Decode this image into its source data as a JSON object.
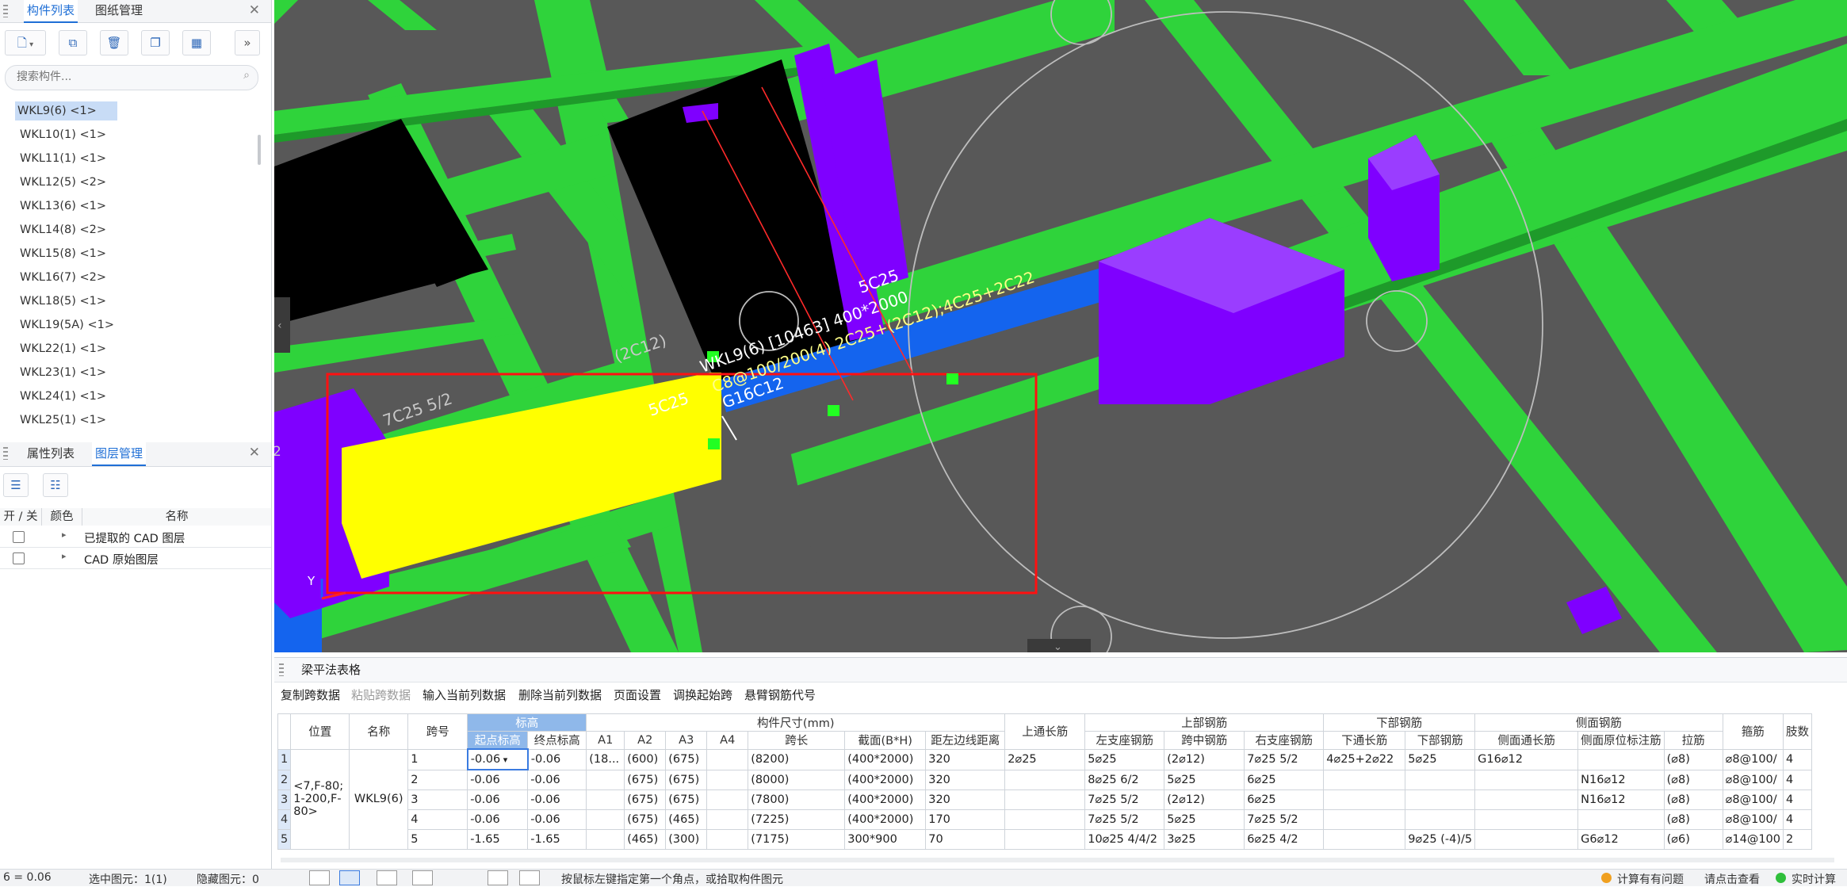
{
  "component_panel": {
    "tabs": [
      "构件列表",
      "图纸管理"
    ],
    "active_tab": 0,
    "search_placeholder": "搜索构件...",
    "items": [
      "WKL9(6) <1>",
      "WKL10(1) <1>",
      "WKL11(1) <1>",
      "WKL12(5) <2>",
      "WKL13(6) <1>",
      "WKL14(8) <2>",
      "WKL15(8) <1>",
      "WKL16(7) <2>",
      "WKL18(5) <1>",
      "WKL19(5A) <1>",
      "WKL22(1) <1>",
      "WKL23(1) <1>",
      "WKL24(1) <1>",
      "WKL25(1) <1>"
    ],
    "selected_index": 0
  },
  "layer_panel": {
    "tabs": [
      "属性列表",
      "图层管理"
    ],
    "active_tab": 1,
    "columns": [
      "开 / 关",
      "颜色",
      "名称"
    ],
    "rows": [
      "已提取的 CAD 图层",
      "CAD 原始图层"
    ]
  },
  "viewport": {
    "labels": {
      "span_label": "5C25",
      "span_label2": "5C25",
      "left_label": "7C25 5/2",
      "small_label": "(2C12)",
      "beam_line1": "WKL9(6) [10463] 400*2000",
      "beam_line2": "C8@100/200(4) 2C25+(2C12);4C25+2C22",
      "beam_line3": "G16C12",
      "axis_y": "Y",
      "edge_num": "2"
    },
    "colors": {
      "beam": "#2fd33b",
      "column": "#7f00ff",
      "selected": "#ffff00",
      "blue": "#1464ee",
      "box": "#ff1010"
    }
  },
  "table_panel": {
    "title": "梁平法表格",
    "actions": [
      "复制跨数据",
      "粘贴跨数据",
      "输入当前列数据",
      "删除当前列数据",
      "页面设置",
      "调换起始跨",
      "悬臂钢筋代号"
    ],
    "disabled_actions": [
      1
    ],
    "group_headers": {
      "elevation": "标高",
      "size": "构件尺寸(mm)",
      "top_bar": "上部钢筋",
      "bottom_bar": "下部钢筋",
      "side_bar": "侧面钢筋"
    },
    "columns": {
      "pos": "位置",
      "name": "名称",
      "span": "跨号",
      "start_el": "起点标高",
      "end_el": "终点标高",
      "a1": "A1",
      "a2": "A2",
      "a3": "A3",
      "a4": "A4",
      "span_len": "跨长",
      "section": "截面(B*H)",
      "dist": "距左边线距离",
      "top_cont": "上通长筋",
      "left_sup": "左支座钢筋",
      "mid_top": "跨中钢筋",
      "right_sup": "右支座钢筋",
      "bot_cont": "下通长筋",
      "bot_bar": "下部钢筋",
      "side_cont": "侧面通长筋",
      "side_orig": "侧面原位标注筋",
      "tie": "拉筋",
      "stirrup": "箍筋",
      "legs": "肢数"
    },
    "row_numbers": [
      "1",
      "2",
      "3",
      "4",
      "5"
    ],
    "position": "<7,F-80;1-200,F-80>",
    "beam_name": "WKL9(6)",
    "rows": [
      [
        "1",
        "-0.06",
        "-0.06",
        "(18...",
        "(600)",
        "(675)",
        "",
        "(8200)",
        "(400*2000)",
        "320",
        "2⌀25",
        "5⌀25",
        "(2⌀12)",
        "7⌀25 5/2",
        "4⌀25+2⌀22",
        "5⌀25",
        "G16⌀12",
        "",
        "(⌀8)",
        "⌀8@100/",
        "4"
      ],
      [
        "2",
        "-0.06",
        "-0.06",
        "",
        "(675)",
        "(675)",
        "",
        "(8000)",
        "(400*2000)",
        "320",
        "",
        "8⌀25 6/2",
        "5⌀25",
        "6⌀25",
        "",
        "",
        "",
        "N16⌀12",
        "(⌀8)",
        "⌀8@100/",
        "4"
      ],
      [
        "3",
        "-0.06",
        "-0.06",
        "",
        "(675)",
        "(675)",
        "",
        "(7800)",
        "(400*2000)",
        "320",
        "",
        "7⌀25 5/2",
        "(2⌀12)",
        "6⌀25",
        "",
        "",
        "",
        "N16⌀12",
        "(⌀8)",
        "⌀8@100/",
        "4"
      ],
      [
        "4",
        "-0.06",
        "-0.06",
        "",
        "(675)",
        "(465)",
        "",
        "(7225)",
        "(400*2000)",
        "170",
        "",
        "7⌀25 5/2",
        "5⌀25",
        "7⌀25 5/2",
        "",
        "",
        "",
        "",
        "(⌀8)",
        "⌀8@100/",
        "4"
      ],
      [
        "5",
        "-1.65",
        "-1.65",
        "",
        "(465)",
        "(300)",
        "",
        "(7175)",
        "300*900",
        "70",
        "",
        "10⌀25 4/4/2",
        "3⌀25",
        "6⌀25 4/2",
        "",
        "9⌀25 (-4)/5",
        "",
        "G6⌀12",
        "(⌀6)",
        "⌀14@100",
        "2"
      ]
    ]
  },
  "status_bar": {
    "left_text": "6 = 0.06",
    "sel_text": "选中图元：1(1)",
    "hidden_text": "隐藏图元：0",
    "mid_text": "按鼠标左键指定第一个角点，或拾取构件图元",
    "warn_text": "计算有有问题",
    "right_text": "请点击查看",
    "ok_text": "实时计算"
  }
}
